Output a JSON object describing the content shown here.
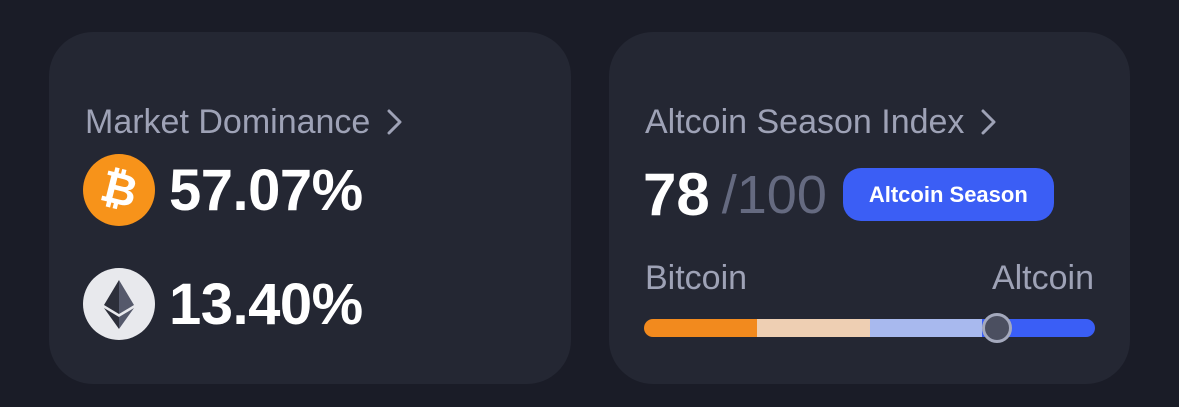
{
  "dominance": {
    "title": "Market Dominance",
    "items": [
      {
        "coin": "Bitcoin",
        "icon": "bitcoin-icon",
        "color": "#f7931a",
        "value": "57.07%"
      },
      {
        "coin": "Ethereum",
        "icon": "ethereum-icon",
        "color": "#e8e9ed",
        "value": "13.40%"
      }
    ]
  },
  "altseason": {
    "title": "Altcoin Season Index",
    "score": "78",
    "max": "/100",
    "badge": "Altcoin Season",
    "badge_color": "#3b5ef5",
    "left_label": "Bitcoin",
    "right_label": "Altcoin",
    "indicator_value": 78,
    "segment_colors": [
      "#f28a1e",
      "#eecfb3",
      "#a8b9ee",
      "#3a5ef6"
    ]
  },
  "icons": {
    "chevron": "chevron-right-icon"
  }
}
